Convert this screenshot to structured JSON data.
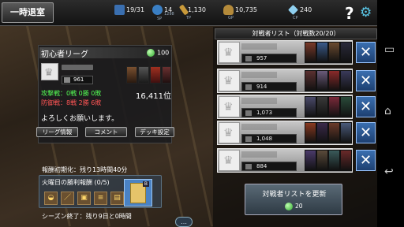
{
  "header": {
    "back_label": "一時退室",
    "stats": [
      {
        "icon": "card-icon",
        "value": "19/31",
        "sub": ""
      },
      {
        "icon": "sp-icon",
        "value": "14",
        "sub": "SP",
        "extra": "1298"
      },
      {
        "icon": "tp-icon",
        "value": "1,130",
        "sub": "TP"
      },
      {
        "icon": "gp-icon",
        "value": "10,735",
        "sub": "GP"
      },
      {
        "icon": "cp-icon",
        "value": "240",
        "sub": "CP"
      }
    ],
    "help_glyph": "?",
    "gear_glyph": "⚙"
  },
  "league": {
    "title": "初心者リーグ",
    "points": "100",
    "level": "961",
    "attack_record": "攻撃戦：0戦 0勝 0敗",
    "defense_record": "防御戦：8戦 2勝 6敗",
    "rank": "16,411位",
    "greeting": "よろしくお願いします。",
    "buttons": [
      "リーグ情報",
      "コメント",
      "デッキ設定"
    ]
  },
  "reward": {
    "reset_label": "報酬初期化：残り13時間40分",
    "title": "火曜日の勝利報酬 (0/5)",
    "next_badge": "B"
  },
  "season": {
    "label": "シーズン終了：残り9日と0時間"
  },
  "opponents": {
    "title": "対戦者リスト（対戦数20/20）",
    "items": [
      {
        "level": "957"
      },
      {
        "level": "914"
      },
      {
        "level": "1,073"
      },
      {
        "level": "1,048"
      },
      {
        "level": "884"
      }
    ],
    "refresh_label": "対戦者リストを更新",
    "refresh_cost": "20"
  },
  "colors": {
    "accent_blue": "#3a6fb0",
    "win_green": "#55ff55",
    "loss_red": "#ff5555"
  }
}
